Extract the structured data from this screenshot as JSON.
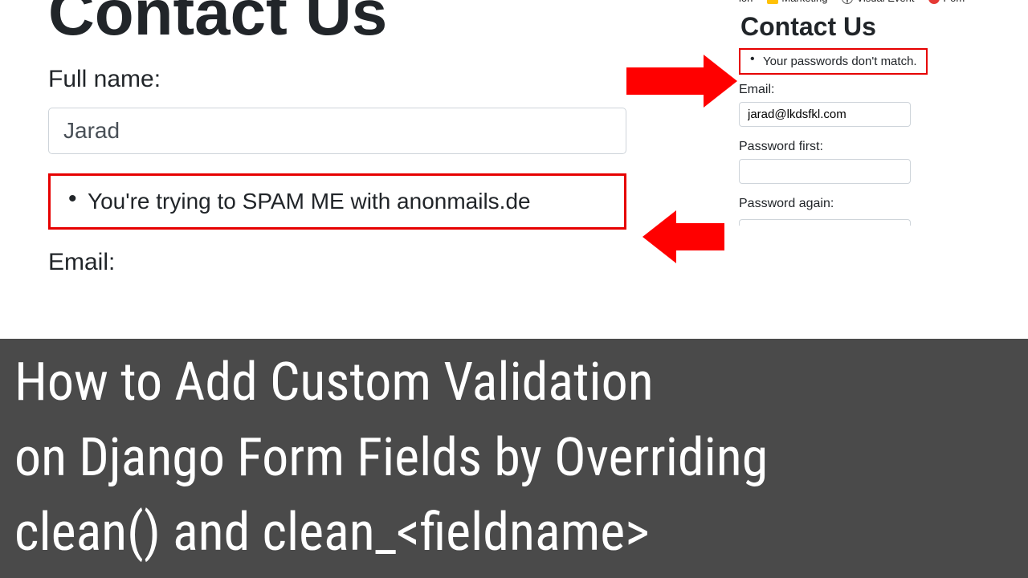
{
  "left": {
    "title": "Contact Us",
    "fullname_label": "Full name:",
    "fullname_value": "Jarad",
    "spam_error": "You're trying to SPAM ME with anonmails.de",
    "email_label": "Email:"
  },
  "right": {
    "bookmarks": {
      "b1_suffix": "ion",
      "b2": "Marketing",
      "b3": "Visual Event",
      "b4_prefix": "Pom"
    },
    "title": "Contact Us",
    "pwd_error": "Your passwords don't match.",
    "email_label": "Email:",
    "email_value": "jarad@lkdsfkl.com",
    "pwd1_label": "Password first:",
    "pwd2_label": "Password again:"
  },
  "banner": {
    "line1": "How to Add Custom Validation",
    "line2": "on Django Form Fields by Overriding",
    "line3": "clean() and clean_<fieldname>"
  }
}
